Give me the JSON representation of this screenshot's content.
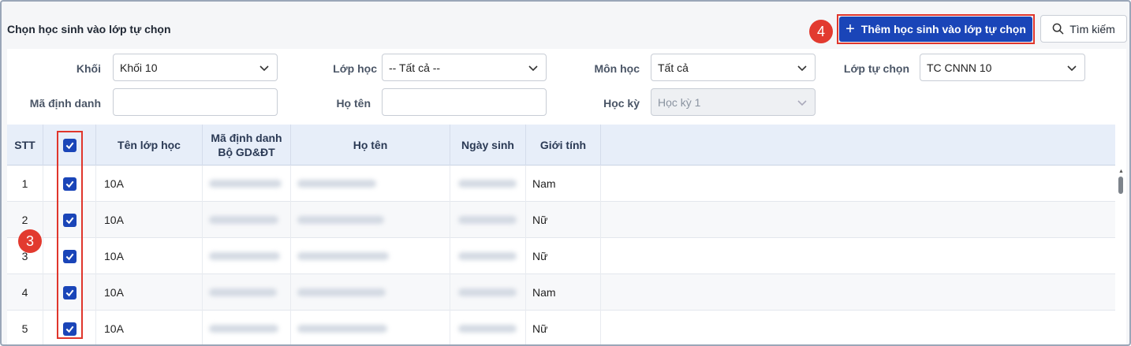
{
  "header": {
    "title": "Chọn học sinh vào lớp tự chọn",
    "step_badge_4": "4",
    "step_badge_3": "3",
    "add_button_label": "Thêm học sinh vào lớp tự chọn",
    "search_button_label": "Tìm kiếm",
    "icons": [
      "plus-icon",
      "search-icon"
    ]
  },
  "filters": {
    "khoi": {
      "label": "Khối",
      "value": "Khối 10"
    },
    "lop_hoc": {
      "label": "Lớp học",
      "value": "-- Tất cả --"
    },
    "mon_hoc": {
      "label": "Môn học",
      "value": "Tất cả"
    },
    "lop_tu_chon": {
      "label": "Lớp tự chọn",
      "value": "TC CNNN 10"
    },
    "ma_dinh_danh": {
      "label": "Mã định danh",
      "value": ""
    },
    "ho_ten": {
      "label": "Họ tên",
      "value": ""
    },
    "hoc_ky": {
      "label": "Học kỳ",
      "value": "Học kỳ 1"
    }
  },
  "table": {
    "columns": {
      "stt": "STT",
      "ten_lop": "Tên lớp học",
      "ma_dinh_danh_1": "Mã định danh",
      "ma_dinh_danh_2": "Bộ GD&ĐT",
      "ho_ten": "Họ tên",
      "ngay_sinh": "Ngày sinh",
      "gioi_tinh": "Giới tính"
    },
    "rows": [
      {
        "stt": "1",
        "lop": "10A",
        "gioi_tinh": "Nam"
      },
      {
        "stt": "2",
        "lop": "10A",
        "gioi_tinh": "Nữ"
      },
      {
        "stt": "3",
        "lop": "10A",
        "gioi_tinh": "Nữ"
      },
      {
        "stt": "4",
        "lop": "10A",
        "gioi_tinh": "Nam"
      },
      {
        "stt": "5",
        "lop": "10A",
        "gioi_tinh": "Nữ"
      }
    ]
  },
  "colors": {
    "primary": "#1a45b8",
    "highlight": "#e0362c",
    "header_bg": "#e7eef9"
  }
}
